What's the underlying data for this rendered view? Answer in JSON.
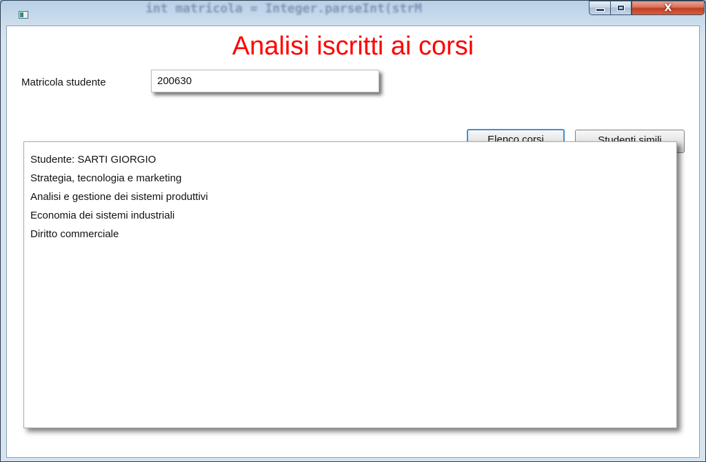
{
  "window": {
    "heading": "Analisi iscritti ai corsi",
    "background_title_text": "int matricola = Integer.parseInt(strM"
  },
  "form": {
    "matricola_label": "Matricola studente",
    "matricola_value": "200630"
  },
  "buttons": {
    "elenco_corsi": "Elenco corsi",
    "studenti_simili": "Studenti simili"
  },
  "output": {
    "lines": [
      "Studente: SARTI GIORGIO",
      "Strategia, tecnologia e marketing",
      "Analisi e gestione dei sistemi produttivi",
      "Economia dei sistemi industriali",
      "Diritto commerciale"
    ]
  },
  "colors": {
    "heading": "#ff0000",
    "focus_border": "#3c8fd9",
    "close_button": "#c33d23"
  },
  "icons": {
    "window_close": "X"
  }
}
